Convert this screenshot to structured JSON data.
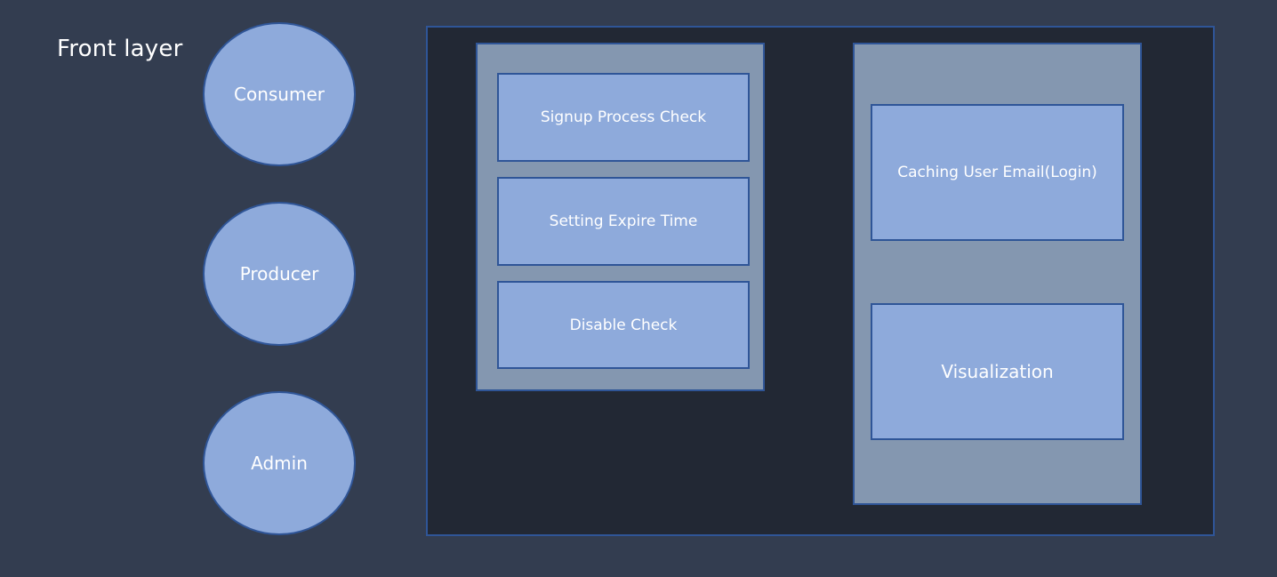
{
  "title": "Front layer",
  "actors": [
    {
      "label": "Consumer"
    },
    {
      "label": "Producer"
    },
    {
      "label": "Admin"
    }
  ],
  "left_group": {
    "items": [
      {
        "label": "Signup Process Check"
      },
      {
        "label": "Setting Expire Time"
      },
      {
        "label": "Disable Check"
      }
    ]
  },
  "right_group": {
    "items": [
      {
        "label": "Caching User Email(Login)"
      },
      {
        "label": "Visualization"
      }
    ]
  },
  "colors": {
    "background": "#333d50",
    "frame": "#222834",
    "group": "#8497b0",
    "node": "#8eaadb",
    "border": "#2f5597",
    "text": "#ffffff"
  }
}
